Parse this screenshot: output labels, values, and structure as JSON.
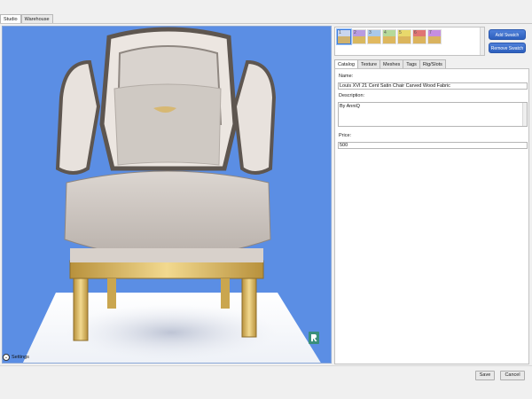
{
  "top_tabs": [
    {
      "label": "Studio",
      "active": true
    },
    {
      "label": "Warehouse",
      "active": false
    }
  ],
  "viewport": {
    "background_color": "#5b8ee4",
    "settings_label": "Settings"
  },
  "swatches": [
    {
      "num": "1",
      "top": "#c9d6ee",
      "bottom": "#cfb26e",
      "selected": true
    },
    {
      "num": "2",
      "top": "#b89be0",
      "bottom": "#d9b85f",
      "selected": false
    },
    {
      "num": "3",
      "top": "#a9c8ea",
      "bottom": "#e1b960",
      "selected": false
    },
    {
      "num": "4",
      "top": "#b5d99a",
      "bottom": "#ddb75e",
      "selected": false
    },
    {
      "num": "5",
      "top": "#e8d86b",
      "bottom": "#dbb55c",
      "selected": false
    },
    {
      "num": "6",
      "top": "#e07474",
      "bottom": "#dcb45d",
      "selected": false
    },
    {
      "num": "7",
      "top": "#c58ee0",
      "bottom": "#d9b35f",
      "selected": false
    }
  ],
  "swatch_buttons": {
    "add": "Add Swatch",
    "remove": "Remove Swatch"
  },
  "inner_tabs": [
    {
      "label": "Catalog",
      "active": true
    },
    {
      "label": "Texture",
      "active": false
    },
    {
      "label": "Meshes",
      "active": false
    },
    {
      "label": "Tags",
      "active": false
    },
    {
      "label": "Rig/Slots",
      "active": false
    }
  ],
  "catalog": {
    "name_label": "Name:",
    "name_value": "Louis XVI 21 Cent Satin Chair Carved Wood Fabric",
    "description_label": "Description:",
    "description_value": "By AnniQ",
    "price_label": "Price:",
    "price_value": "500"
  },
  "footer": {
    "save": "Save",
    "cancel": "Cancel"
  }
}
